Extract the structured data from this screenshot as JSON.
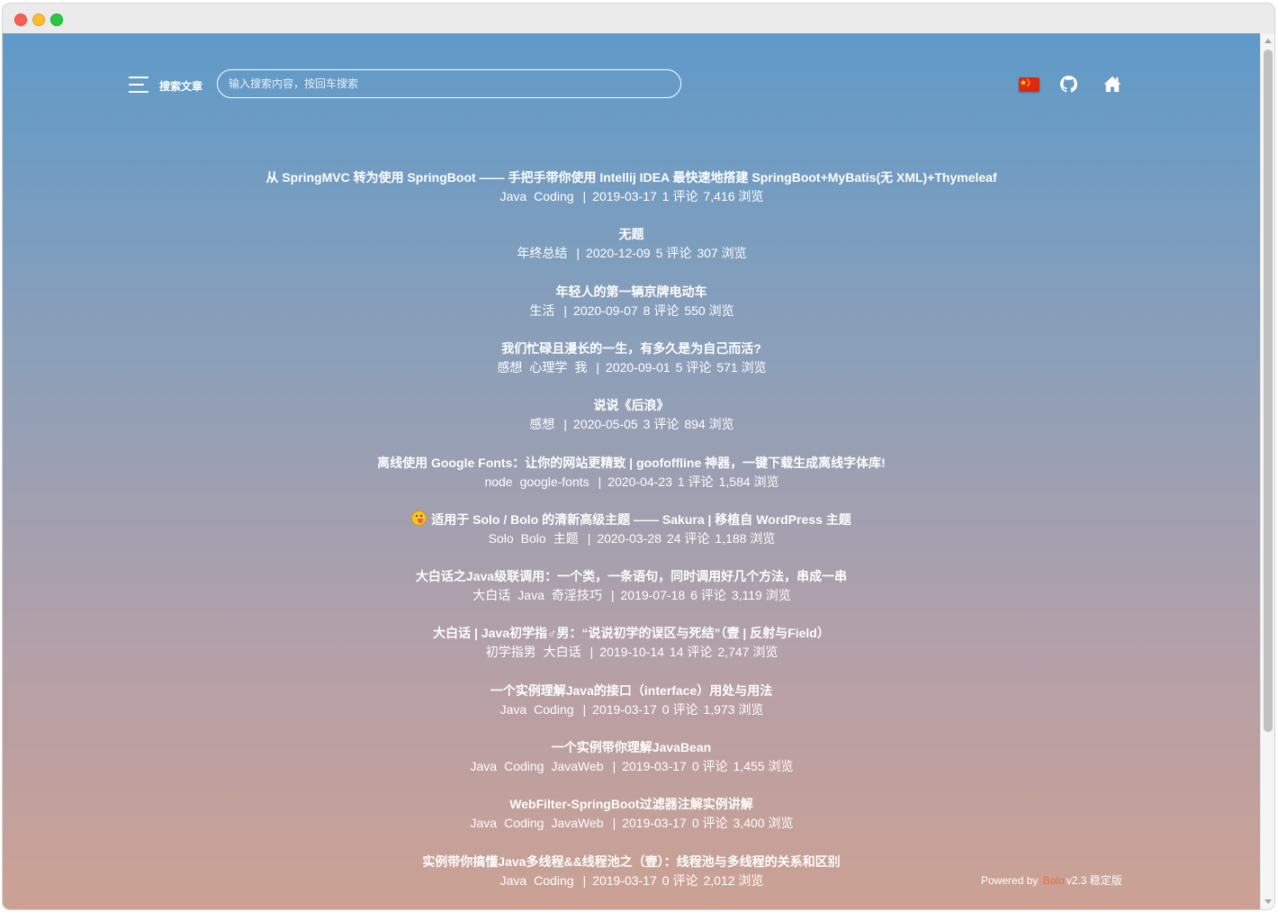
{
  "header": {
    "menu_icon": "menu-icon",
    "search_label": "搜索文章",
    "search_placeholder": "输入搜索内容，按回车搜索",
    "icons": [
      "china-flag-icon",
      "github-icon",
      "home-icon"
    ]
  },
  "articles": [
    {
      "title": "从 SpringMVC 转为使用 SpringBoot —— 手把手带你使用 Intellij IDEA 最快速地搭建 SpringBoot+MyBatis(无 XML)+Thymeleaf",
      "tags": [
        "Java",
        "Coding"
      ],
      "date": "2019-03-17",
      "comments": "1 评论",
      "views": "7,416 浏览"
    },
    {
      "title": "无题",
      "tags": [
        "年终总结"
      ],
      "date": "2020-12-09",
      "comments": "5 评论",
      "views": "307 浏览"
    },
    {
      "title": "年轻人的第一辆京牌电动车",
      "tags": [
        "生活"
      ],
      "date": "2020-09-07",
      "comments": "8 评论",
      "views": "550 浏览"
    },
    {
      "title": "我们忙碌且漫长的一生，有多久是为自己而活?",
      "tags": [
        "感想",
        "心理学",
        "我"
      ],
      "date": "2020-09-01",
      "comments": "5 评论",
      "views": "571 浏览"
    },
    {
      "title": "说说《后浪》",
      "tags": [
        "感想"
      ],
      "date": "2020-05-05",
      "comments": "3 评论",
      "views": "894 浏览"
    },
    {
      "title": "离线使用 Google Fonts：让你的网站更精致 | goofoffline 神器，一键下载生成离线字体库!",
      "tags": [
        "node",
        "google-fonts"
      ],
      "date": "2020-04-23",
      "comments": "1 评论",
      "views": "1,584 浏览"
    },
    {
      "title": "适用于 Solo / Bolo 的清新高级主题 —— Sakura | 移植自 WordPress 主题",
      "emoji": "emoji-face-icon",
      "tags": [
        "Solo",
        "Bolo",
        "主题"
      ],
      "date": "2020-03-28",
      "comments": "24 评论",
      "views": "1,188 浏览"
    },
    {
      "title": "大白话之Java级联调用：一个类，一条语句，同时调用好几个方法，串成一串",
      "tags": [
        "大白话",
        "Java",
        "奇淫技巧"
      ],
      "date": "2019-07-18",
      "comments": "6 评论",
      "views": "3,119 浏览"
    },
    {
      "title": "大白话 | Java初学指♂男：“说说初学的误区与死结”（壹 | 反射与Field）",
      "tags": [
        "初学指男",
        "大白话"
      ],
      "date": "2019-10-14",
      "comments": "14 评论",
      "views": "2,747 浏览"
    },
    {
      "title": "一个实例理解Java的接口（interface）用处与用法",
      "tags": [
        "Java",
        "Coding"
      ],
      "date": "2019-03-17",
      "comments": "0 评论",
      "views": "1,973 浏览"
    },
    {
      "title": "一个实例带你理解JavaBean",
      "tags": [
        "Java",
        "Coding",
        "JavaWeb"
      ],
      "date": "2019-03-17",
      "comments": "0 评论",
      "views": "1,455 浏览"
    },
    {
      "title": "WebFilter-SpringBoot过滤器注解实例讲解",
      "tags": [
        "Java",
        "Coding",
        "JavaWeb"
      ],
      "date": "2019-03-17",
      "comments": "0 评论",
      "views": "3,400 浏览"
    },
    {
      "title": "实例带你搞懂Java多线程&&线程池之（壹）：线程池与多线程的关系和区别",
      "tags": [
        "Java",
        "Coding"
      ],
      "date": "2019-03-17",
      "comments": "0 评论",
      "views": "2,012 浏览"
    }
  ],
  "footer": {
    "powered_prefix": "Powered by",
    "powered_brand": "Bolo",
    "powered_suffix": "v2.3 稳定版"
  },
  "colors": {
    "gradient_top": "#5f9ac9",
    "gradient_bottom": "#cca193",
    "brand": "#f06a3d"
  }
}
